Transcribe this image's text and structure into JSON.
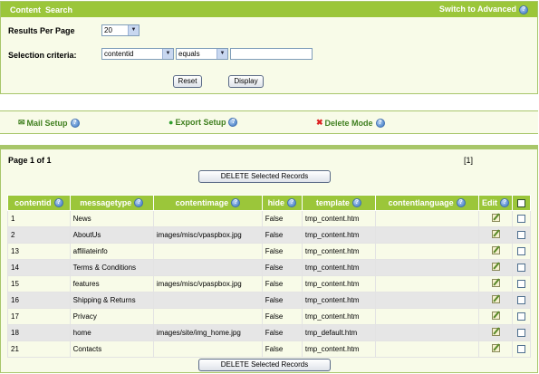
{
  "search": {
    "title": "Content  Search",
    "switch_label": "Switch to Advanced",
    "results_label": "Results Per Page",
    "results_value": "20",
    "criteria_label": "Selection criteria:",
    "field_value": "contentid",
    "operator_value": "equals",
    "criteria_text": "",
    "reset_label": "Reset",
    "display_label": "Display"
  },
  "tools": {
    "mail": "Mail Setup",
    "export": "Export Setup",
    "delete": "Delete Mode"
  },
  "results": {
    "page_info": "Page 1 of 1",
    "page_link": "[1]",
    "delete_top": "DELETE Selected Records",
    "delete_bottom": "DELETE Selected Records",
    "columns": [
      "contentid",
      "messagetype",
      "contentimage",
      "hide",
      "template",
      "contentlanguage",
      "Edit"
    ],
    "rows": [
      {
        "contentid": "1",
        "messagetype": "News",
        "contentimage": "",
        "hide": "False",
        "template": "tmp_content.htm",
        "contentlanguage": ""
      },
      {
        "contentid": "2",
        "messagetype": "AboutUs",
        "contentimage": "images/misc/vpaspbox.jpg",
        "hide": "False",
        "template": "tmp_content.htm",
        "contentlanguage": ""
      },
      {
        "contentid": "13",
        "messagetype": "affiliateinfo",
        "contentimage": "",
        "hide": "False",
        "template": "tmp_content.htm",
        "contentlanguage": ""
      },
      {
        "contentid": "14",
        "messagetype": "Terms & Conditions",
        "contentimage": "",
        "hide": "False",
        "template": "tmp_content.htm",
        "contentlanguage": ""
      },
      {
        "contentid": "15",
        "messagetype": "features",
        "contentimage": "images/misc/vpaspbox.jpg",
        "hide": "False",
        "template": "tmp_content.htm",
        "contentlanguage": ""
      },
      {
        "contentid": "16",
        "messagetype": "Shipping & Returns",
        "contentimage": "",
        "hide": "False",
        "template": "tmp_content.htm",
        "contentlanguage": ""
      },
      {
        "contentid": "17",
        "messagetype": "Privacy",
        "contentimage": "",
        "hide": "False",
        "template": "tmp_content.htm",
        "contentlanguage": ""
      },
      {
        "contentid": "18",
        "messagetype": "home",
        "contentimage": "images/site/img_home.jpg",
        "hide": "False",
        "template": "tmp_default.htm",
        "contentlanguage": ""
      },
      {
        "contentid": "21",
        "messagetype": "Contacts",
        "contentimage": "",
        "hide": "False",
        "template": "tmp_content.htm",
        "contentlanguage": ""
      }
    ]
  },
  "colors": {
    "header_green": "#9bc63a",
    "panel_bg": "#f8fbe8",
    "border_green": "#a8c66a",
    "tool_green": "#3f7f1e"
  },
  "icons": [
    "help-icon",
    "mail-icon",
    "export-icon",
    "delete-icon",
    "edit-icon"
  ]
}
